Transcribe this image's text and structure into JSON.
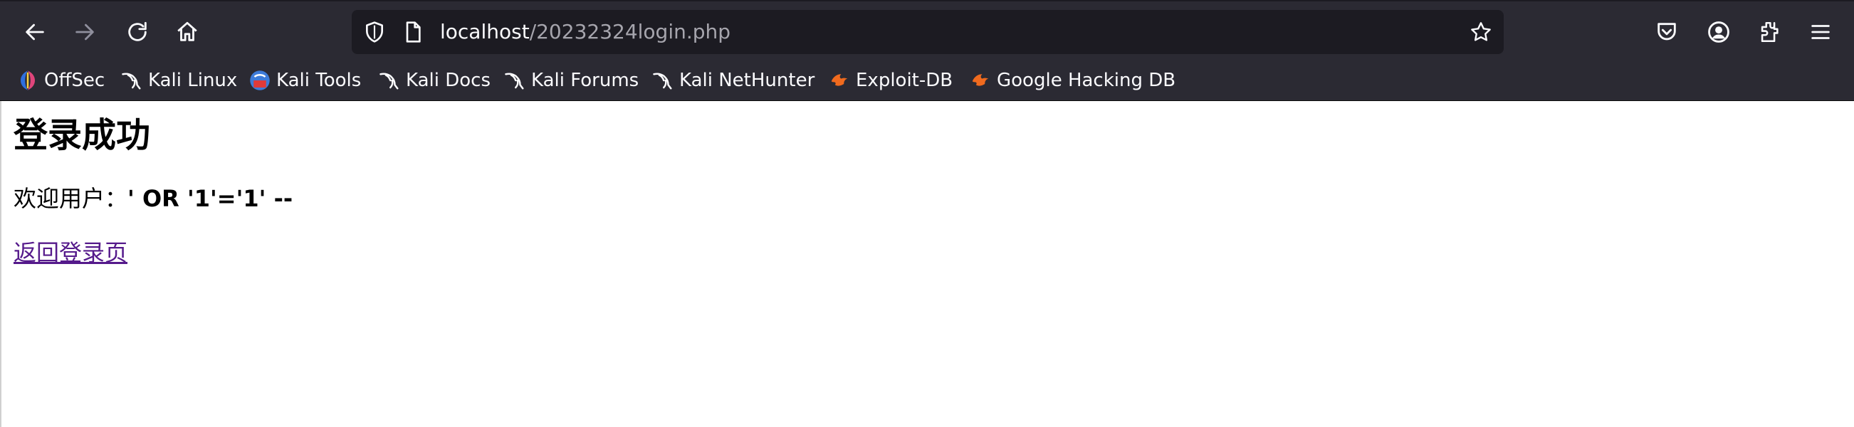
{
  "toolbar": {
    "url_host": "localhost",
    "url_path": "/20232324login.php"
  },
  "bookmarks": [
    {
      "label": "OffSec",
      "icon": "offsec-icon"
    },
    {
      "label": "Kali Linux",
      "icon": "kali-dragon-icon"
    },
    {
      "label": "Kali Tools",
      "icon": "kali-tools-icon"
    },
    {
      "label": "Kali Docs",
      "icon": "kali-dragon-icon"
    },
    {
      "label": "Kali Forums",
      "icon": "kali-dragon-icon"
    },
    {
      "label": "Kali NetHunter",
      "icon": "kali-dragon-icon"
    },
    {
      "label": "Exploit-DB",
      "icon": "exploit-db-icon"
    },
    {
      "label": "Google Hacking DB",
      "icon": "exploit-db-icon"
    }
  ],
  "page": {
    "heading": "登录成功",
    "welcome_prefix": "欢迎用户：",
    "username": "' OR '1'='1' --",
    "back_link": "返回登录页"
  },
  "colors": {
    "toolbar_bg": "#2b2a33",
    "urlbar_bg": "#1c1b22",
    "visited_link": "#551a8b"
  }
}
